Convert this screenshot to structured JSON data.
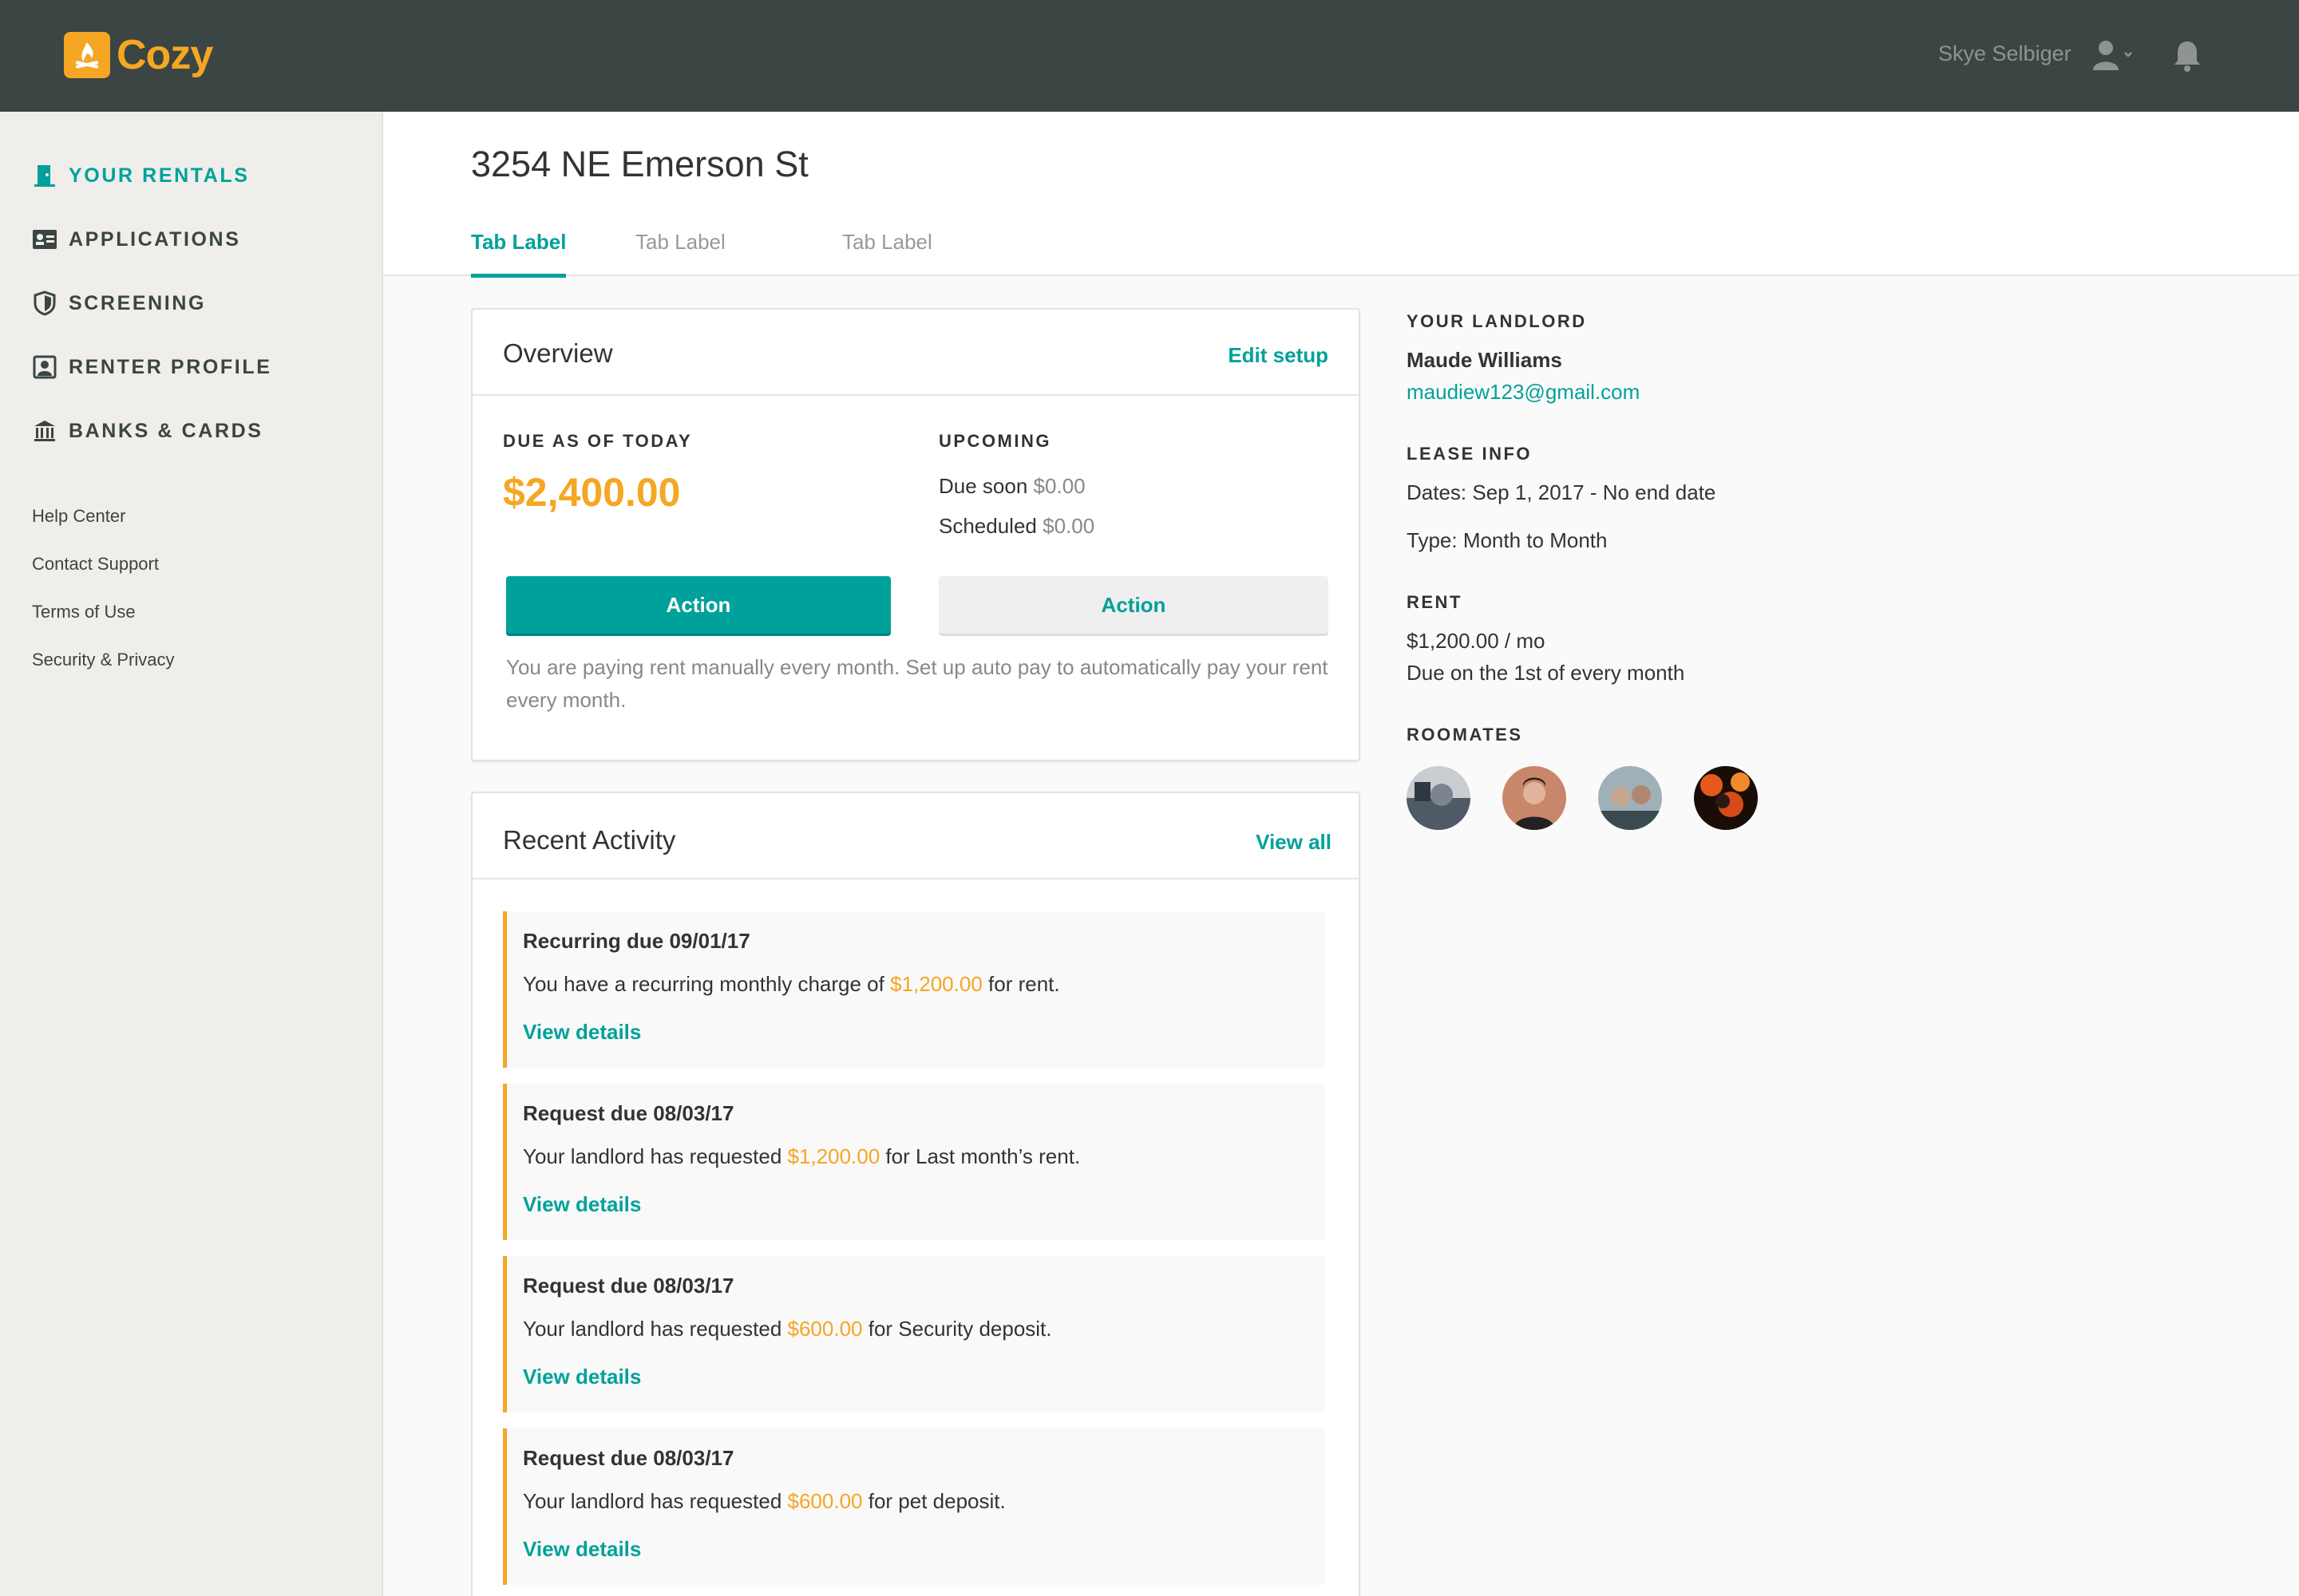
{
  "brand": {
    "name": "Cozy",
    "color": "#f5a623"
  },
  "topbar": {
    "user_name": "Skye Selbiger",
    "user_icon": "user-icon",
    "bell_icon": "bell-icon"
  },
  "sidebar": {
    "items": [
      {
        "label": "YOUR RENTALS",
        "icon": "door-icon",
        "active": true
      },
      {
        "label": "APPLICATIONS",
        "icon": "id-card-icon",
        "active": false
      },
      {
        "label": "SCREENING",
        "icon": "shield-icon",
        "active": false
      },
      {
        "label": "RENTER PROFILE",
        "icon": "profile-icon",
        "active": false
      },
      {
        "label": "BANKS & CARDS",
        "icon": "bank-icon",
        "active": false
      }
    ],
    "links": [
      "Help Center",
      "Contact Support",
      "Terms of Use",
      "Security & Privacy"
    ]
  },
  "header": {
    "title": "3254 NE Emerson St",
    "tabs": [
      "Tab Label",
      "Tab Label",
      "Tab Label"
    ]
  },
  "overview": {
    "title": "Overview",
    "edit_link": "Edit setup",
    "due_label": "DUE AS OF TODAY",
    "due_amount": "$2,400.00",
    "upcoming_label": "UPCOMING",
    "due_soon_label": "Due soon",
    "due_soon_value": "$0.00",
    "scheduled_label": "Scheduled",
    "scheduled_value": "$0.00",
    "primary_action": "Action",
    "secondary_action": "Action",
    "note": "You are paying rent manually every month. Set up auto pay to automatically pay your rent every month."
  },
  "activity": {
    "title": "Recent Activity",
    "view_all": "View all",
    "items": [
      {
        "title": "Recurring due 09/01/17",
        "pre": "You have a recurring monthly charge of",
        "amount": "$1,200.00",
        "post": "for rent.",
        "link": "View details"
      },
      {
        "title": "Request due 08/03/17",
        "pre": "Your landlord has requested",
        "amount": "$1,200.00",
        "post": "for Last month’s rent.",
        "link": "View details"
      },
      {
        "title": "Request due 08/03/17",
        "pre": "Your landlord has requested",
        "amount": "$600.00",
        "post": "for Security deposit.",
        "link": "View details"
      },
      {
        "title": "Request due 08/03/17",
        "pre": "Your landlord has requested",
        "amount": "$600.00",
        "post": "for pet deposit.",
        "link": "View details"
      }
    ]
  },
  "landlord": {
    "label": "YOUR LANDLORD",
    "name": "Maude Williams",
    "email": "maudiew123@gmail.com"
  },
  "lease": {
    "label": "LEASE INFO",
    "dates": "Dates: Sep 1, 2017 - No end date",
    "type": "Type: Month to Month"
  },
  "rent": {
    "label": "RENT",
    "amount": "$1,200.00 / mo",
    "due": "Due on the 1st of every month"
  },
  "roommates": {
    "label": "ROOMATES",
    "avatars": [
      "avatar-1",
      "avatar-2",
      "avatar-3",
      "avatar-4"
    ]
  },
  "colors": {
    "accent": "#00a19a",
    "topbar": "#3b4543",
    "amount": "#f5a623",
    "sidebar": "#efeeea"
  }
}
